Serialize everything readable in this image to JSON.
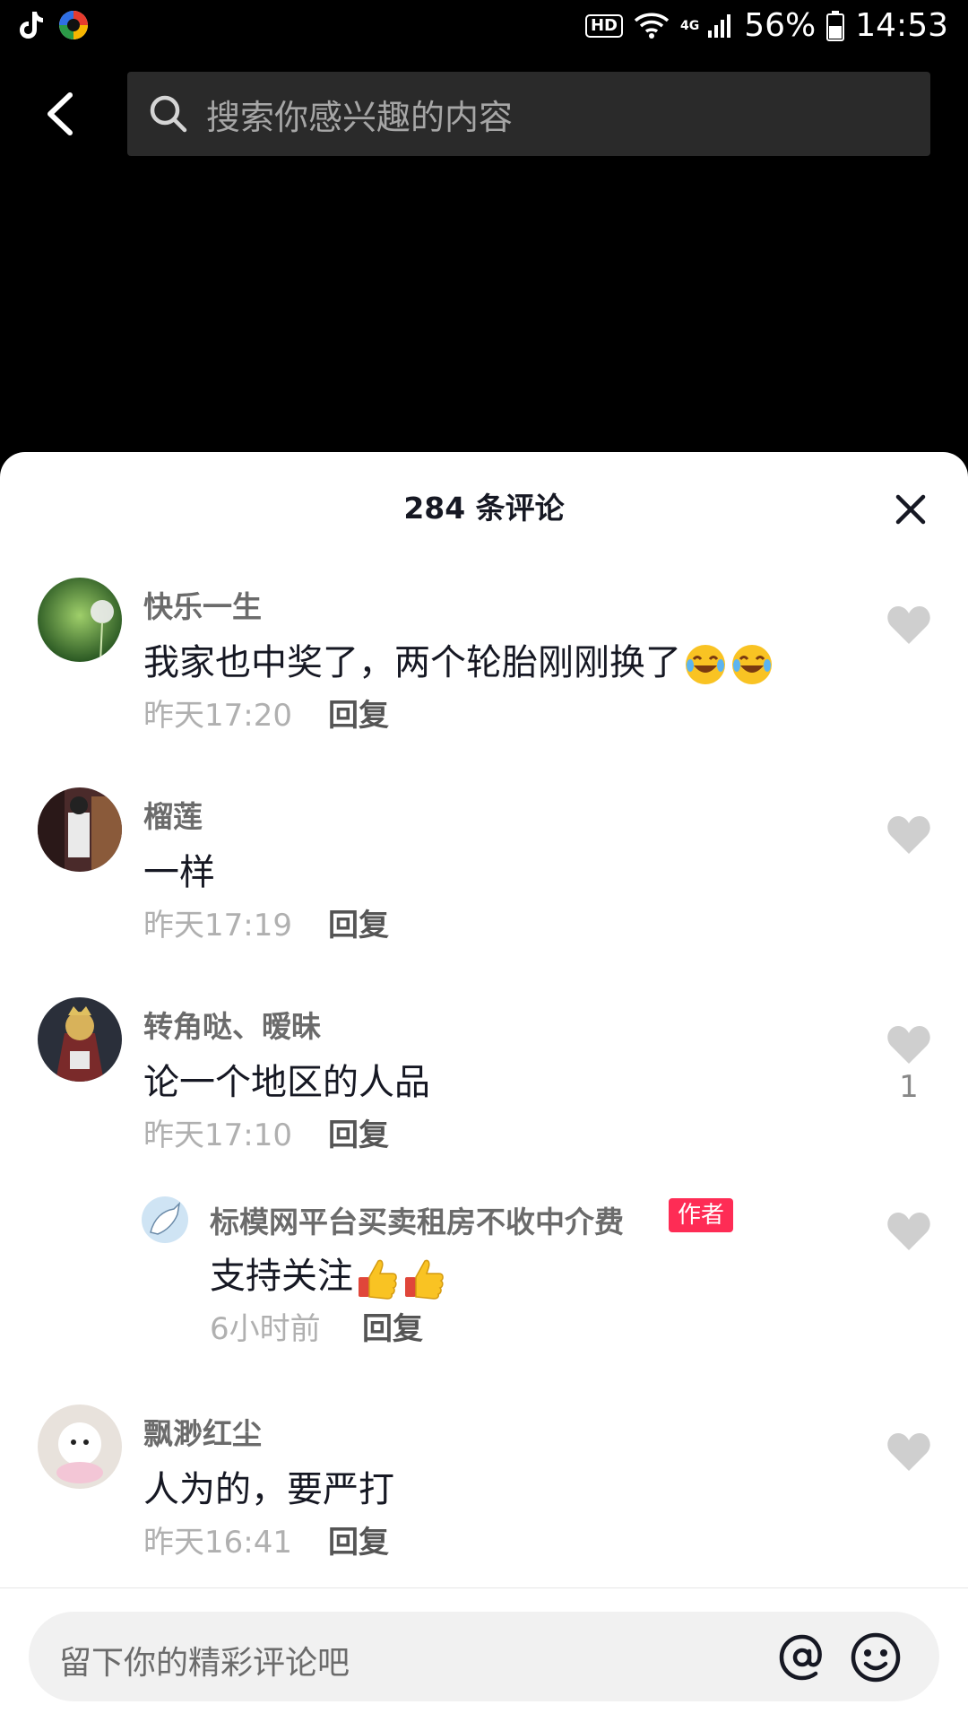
{
  "status_bar": {
    "network": "4G",
    "battery": "56%",
    "time": "14:53",
    "hd": "HD"
  },
  "header": {
    "search_placeholder": "搜索你感兴趣的内容"
  },
  "sheet": {
    "title": "284 条评论"
  },
  "comments": [
    {
      "user": "快乐一生",
      "text": "我家也中奖了，两个轮胎刚刚换了",
      "time": "昨天17:20",
      "reply": "回复",
      "likes": ""
    },
    {
      "user": "榴莲",
      "text": "一样",
      "time": "昨天17:19",
      "reply": "回复",
      "likes": ""
    },
    {
      "user": "转角哒、暧昧",
      "text": "论一个地区的人品",
      "time": "昨天17:10",
      "reply": "回复",
      "likes": "1"
    },
    {
      "user": "标模网平台买卖租房不收中介费",
      "tag": "作者",
      "text": "支持关注",
      "time": "6小时前",
      "reply": "回复",
      "likes": ""
    },
    {
      "user": "飘渺红尘",
      "text": "人为的，要严打",
      "time": "昨天16:41",
      "reply": "回复",
      "likes": ""
    }
  ],
  "input": {
    "placeholder": "留下你的精彩评论吧"
  },
  "colors": {
    "accent": "#fe2c55",
    "heart": "#cfcfcf",
    "background": "#000000"
  },
  "icons": [
    "tiktok-icon",
    "app-icon",
    "wifi-icon",
    "signal-icon",
    "battery-icon",
    "back-icon",
    "search-icon",
    "close-icon",
    "heart-icon",
    "laughing-emoji",
    "thumbs-up-emoji",
    "at-icon",
    "emoji-icon"
  ]
}
